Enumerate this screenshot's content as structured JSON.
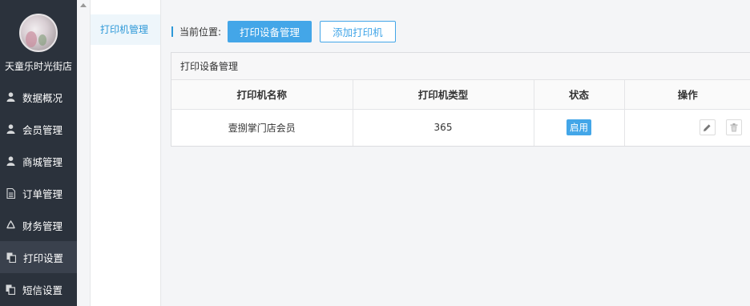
{
  "sidebar": {
    "store_name": "天童乐时光街店",
    "items": [
      {
        "label": "数据概况",
        "icon": "user-icon",
        "active": false
      },
      {
        "label": "会员管理",
        "icon": "user-icon",
        "active": false
      },
      {
        "label": "商城管理",
        "icon": "user-icon",
        "active": false
      },
      {
        "label": "订单管理",
        "icon": "document-icon",
        "active": false
      },
      {
        "label": "财务管理",
        "icon": "recycle-icon",
        "active": false
      },
      {
        "label": "打印设置",
        "icon": "copy-icon",
        "active": true
      },
      {
        "label": "短信设置",
        "icon": "copy-icon",
        "active": false
      }
    ]
  },
  "submenu": {
    "items": [
      {
        "label": "打印机管理",
        "active": true
      }
    ]
  },
  "main": {
    "location_label": "当前位置:",
    "primary_button": "打印设备管理",
    "secondary_button": "添加打印机",
    "panel_title": "打印设备管理",
    "table": {
      "headers": [
        "打印机名称",
        "打印机类型",
        "状态",
        "操作"
      ],
      "rows": [
        {
          "name": "壹捌掌门店会员",
          "type": "365",
          "status": "启用",
          "actions": [
            "edit-icon",
            "trash-icon"
          ]
        }
      ]
    }
  },
  "colors": {
    "sidebar_bg": "#2b323c",
    "accent": "#43a6e8",
    "submenu_active_text": "#2e99d8"
  }
}
